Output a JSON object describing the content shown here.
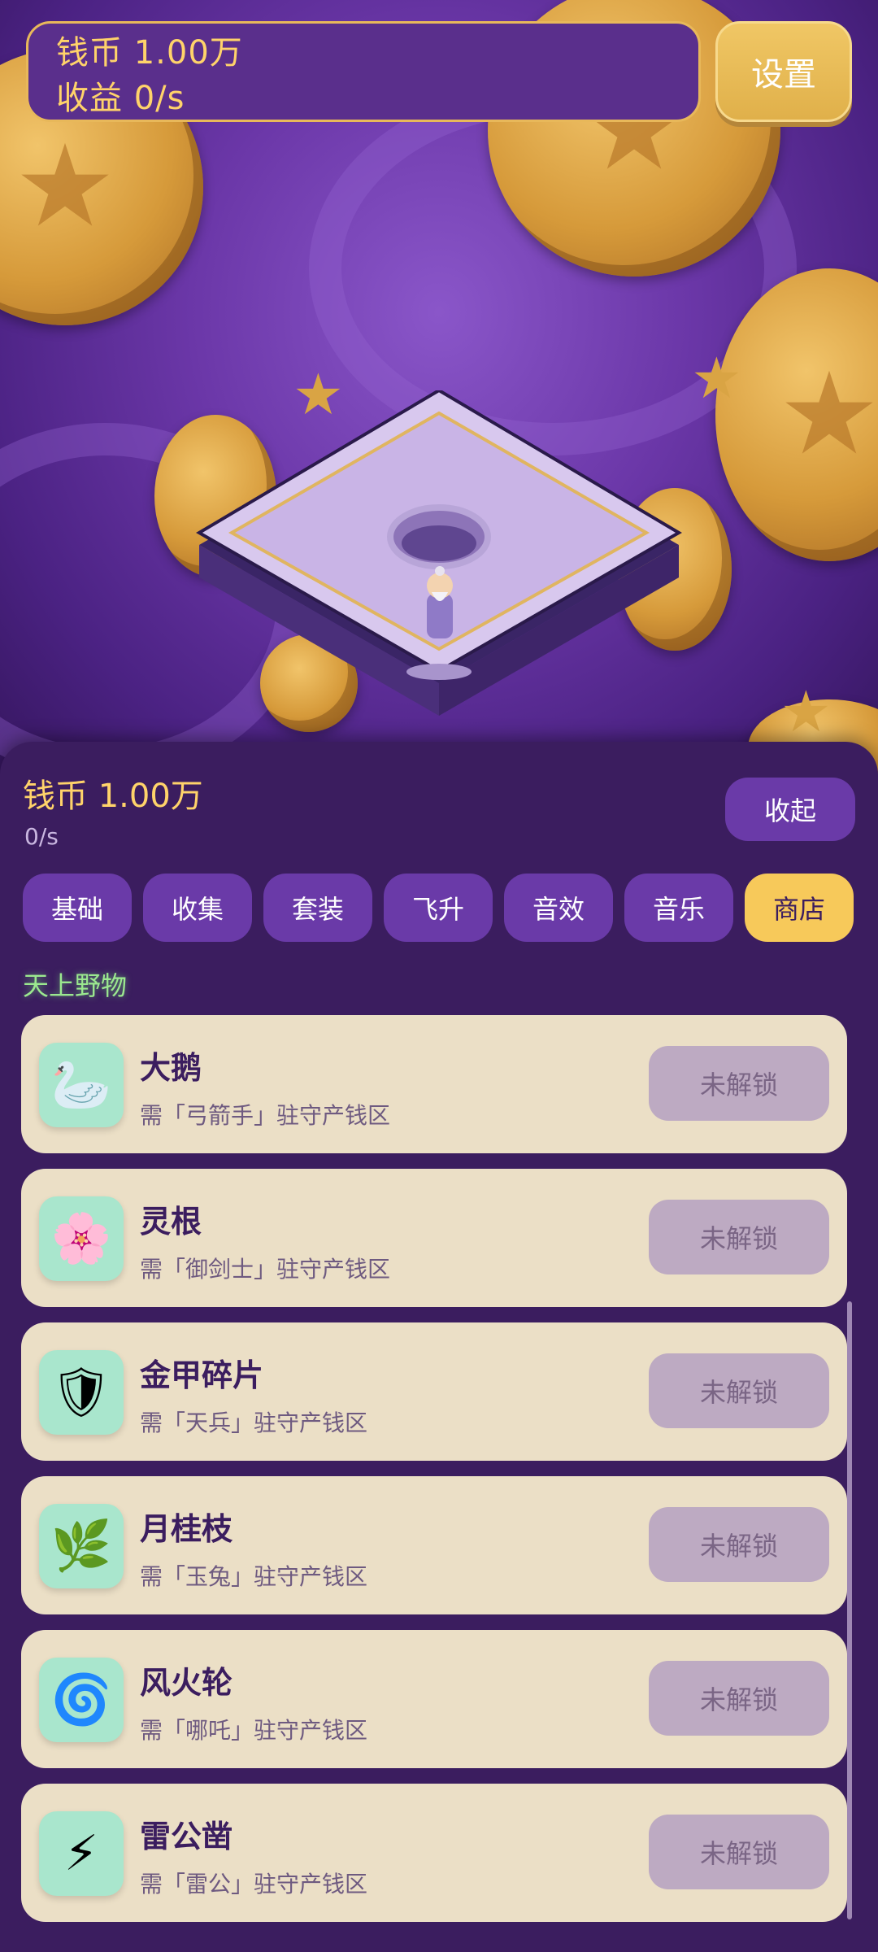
{
  "hud": {
    "coins_text": "钱币 1.00万",
    "income_text": "收益 0/s",
    "settings_label": "设置"
  },
  "panel": {
    "coins_text": "钱币 1.00万",
    "rate_text": "0/s",
    "collapse_label": "收起",
    "tabs": [
      {
        "label": "基础"
      },
      {
        "label": "收集"
      },
      {
        "label": "套装"
      },
      {
        "label": "飞升"
      },
      {
        "label": "音效"
      },
      {
        "label": "音乐"
      },
      {
        "label": "商店",
        "active": true
      }
    ],
    "section_title": "天上野物",
    "items": [
      {
        "name": "大鹅",
        "requirement": "需「弓箭手」驻守产钱区",
        "button": "未解锁",
        "icon": "goose-icon",
        "glyph": "🦢"
      },
      {
        "name": "灵根",
        "requirement": "需「御剑士」驻守产钱区",
        "button": "未解锁",
        "icon": "spirit-root-icon",
        "glyph": "🌸"
      },
      {
        "name": "金甲碎片",
        "requirement": "需「天兵」驻守产钱区",
        "button": "未解锁",
        "icon": "armor-shard-icon",
        "glyph": "🛡"
      },
      {
        "name": "月桂枝",
        "requirement": "需「玉兔」驻守产钱区",
        "button": "未解锁",
        "icon": "laurel-branch-icon",
        "glyph": "🌿"
      },
      {
        "name": "风火轮",
        "requirement": "需「哪吒」驻守产钱区",
        "button": "未解锁",
        "icon": "fire-wheel-icon",
        "glyph": "🌀"
      },
      {
        "name": "雷公凿",
        "requirement": "需「雷公」驻守产钱区",
        "button": "未解锁",
        "icon": "thunder-chisel-icon",
        "glyph": "⚡"
      }
    ]
  },
  "colors": {
    "accent_gold": "#f7c95a",
    "panel_bg": "#3b1d5f",
    "tab_bg": "#6a3aa8",
    "card_bg": "#ebdfc6",
    "locked_button": "#bdaac2"
  }
}
